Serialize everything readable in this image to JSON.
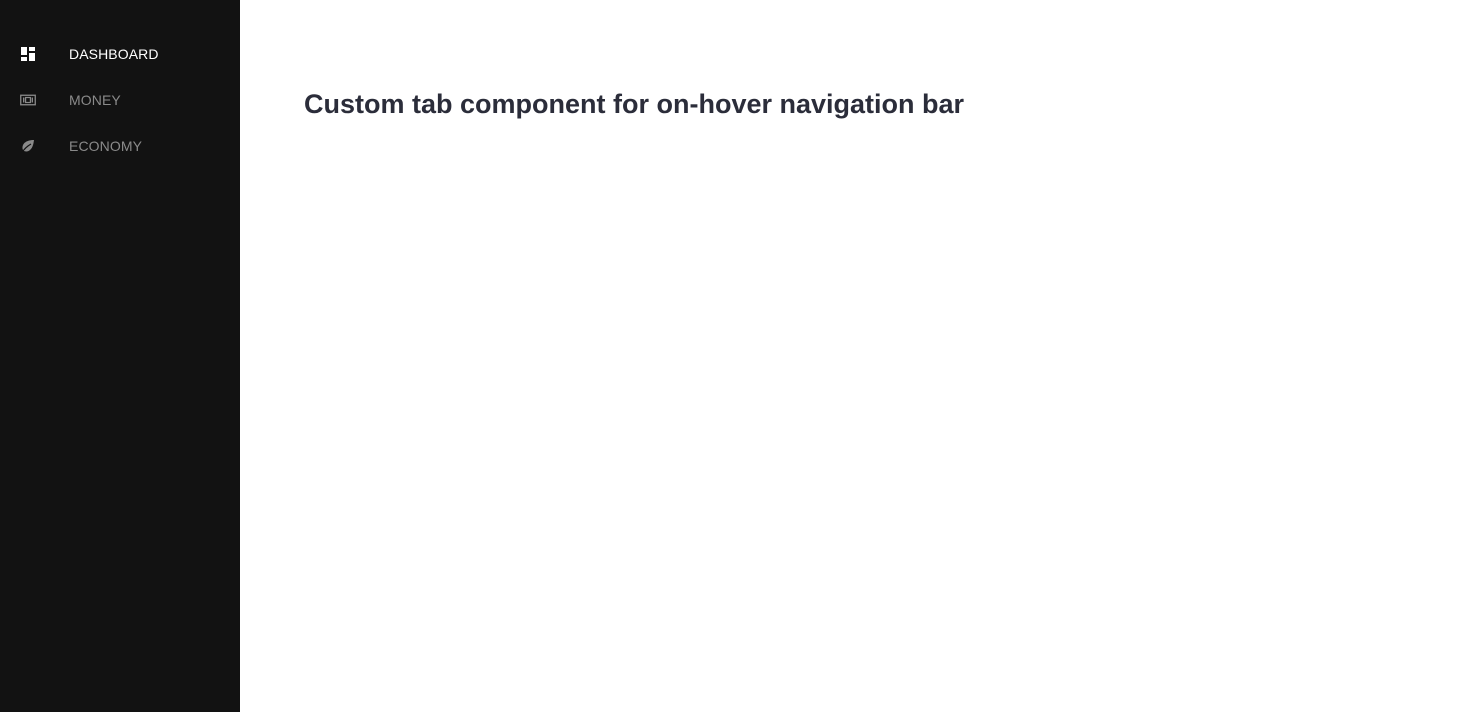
{
  "sidebar": {
    "items": [
      {
        "label": "DASHBOARD",
        "icon": "dashboard-icon",
        "active": true
      },
      {
        "label": "MONEY",
        "icon": "money-icon",
        "active": false
      },
      {
        "label": "ECONOMY",
        "icon": "leaf-icon",
        "active": false
      }
    ]
  },
  "main": {
    "title": "Custom tab component for on-hover navigation bar"
  },
  "colors": {
    "sidebar_bg": "#121212",
    "active_text": "#ffffff",
    "inactive_text": "#8a8a8a",
    "title_text": "#2b2d3a"
  }
}
